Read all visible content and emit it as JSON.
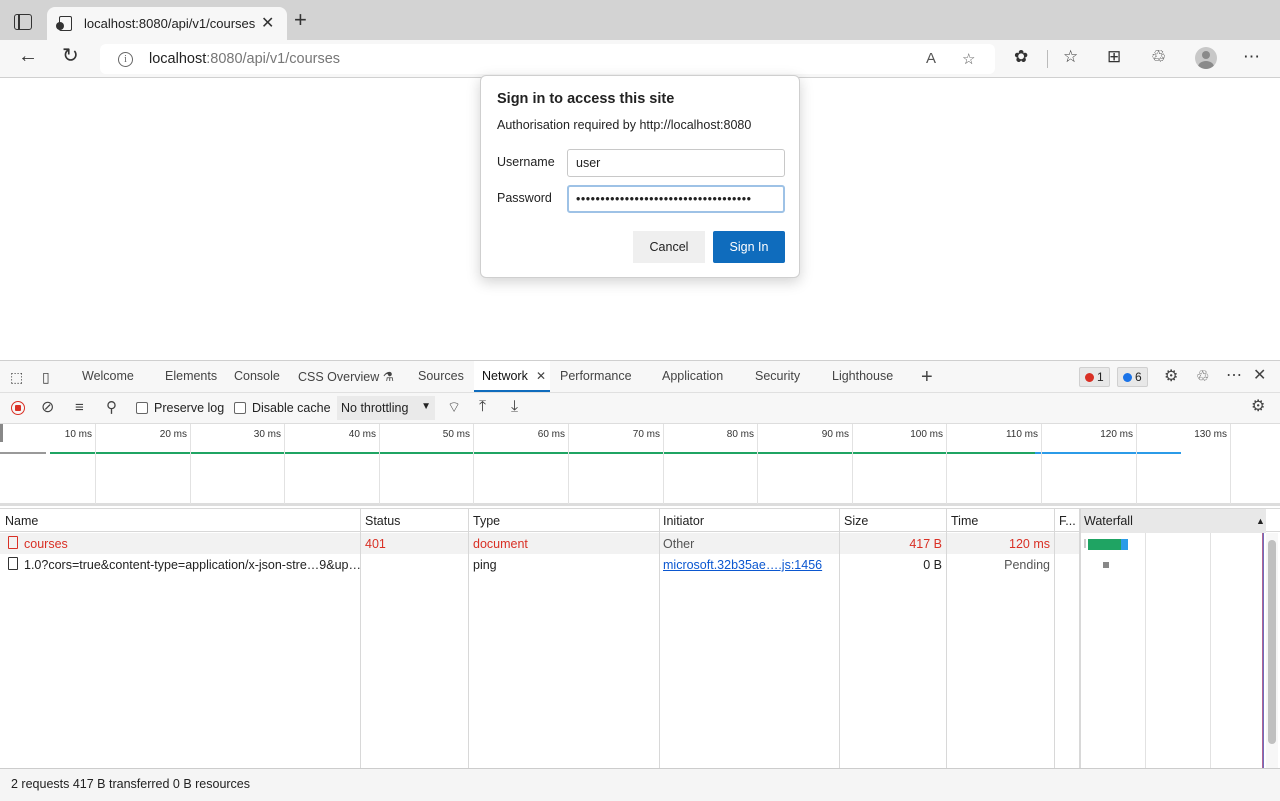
{
  "browser": {
    "tab_title": "localhost:8080/api/v1/courses",
    "url_host": "localhost",
    "url_rest": ":8080/api/v1/courses",
    "icons": [
      "tab-actions-icon",
      "back-icon",
      "refresh-icon",
      "info-icon",
      "read-aloud-icon",
      "add-favorite-icon",
      "extensions-icon",
      "favorites-icon",
      "collections-icon",
      "share-icon",
      "profile-avatar",
      "more-icon"
    ]
  },
  "dialog": {
    "title": "Sign in to access this site",
    "subtitle": "Authorisation required by http://localhost:8080",
    "username_label": "Username",
    "username_value": "user",
    "password_label": "Password",
    "password_value": "••••••••••••••••••••••••••••••••••••",
    "cancel_label": "Cancel",
    "signin_label": "Sign In",
    "accent_color": "#0f6cbd"
  },
  "devtools": {
    "tabs": [
      {
        "label": "Welcome"
      },
      {
        "label": "Elements"
      },
      {
        "label": "Console"
      },
      {
        "label": "CSS Overview ⚗"
      },
      {
        "label": "Sources"
      },
      {
        "label": "Network",
        "active": true
      },
      {
        "label": "Performance"
      },
      {
        "label": "Application"
      },
      {
        "label": "Security"
      },
      {
        "label": "Lighthouse"
      }
    ],
    "error_count": "1",
    "message_count": "6",
    "toolbar": {
      "preserve_log": "Preserve log",
      "disable_cache": "Disable cache",
      "throttling": "No throttling"
    },
    "overview_ticks": [
      "10 ms",
      "20 ms",
      "30 ms",
      "40 ms",
      "50 ms",
      "60 ms",
      "70 ms",
      "80 ms",
      "90 ms",
      "100 ms",
      "110 ms",
      "120 ms",
      "130 ms"
    ],
    "columns": [
      "Name",
      "Status",
      "Type",
      "Initiator",
      "Size",
      "Time",
      "F...",
      "Waterfall"
    ],
    "requests": [
      {
        "name": "courses",
        "status": "401",
        "type": "document",
        "initiator": "Other",
        "size": "417 B",
        "time": "120 ms",
        "error": true
      },
      {
        "name": "1.0?cors=true&content-type=application/x-json-stre…9&up…",
        "status": "",
        "type": "ping",
        "initiator": "microsoft.32b35ae….js:1456",
        "size": "0 B",
        "time": "Pending",
        "error": false
      }
    ],
    "summary": "2 requests  417 B transferred  0 B resources"
  }
}
